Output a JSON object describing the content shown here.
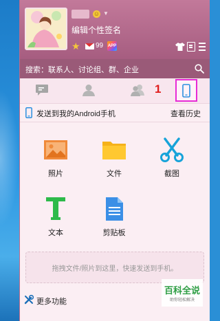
{
  "profile": {
    "signature": "编辑个性签名",
    "mail_count": "99",
    "app_badge": "APP",
    "level_icon": "gold-vip-badge"
  },
  "search": {
    "placeholder": "搜索：联系人、讨论组、群、企业"
  },
  "tabs": {
    "annotation_number": "1",
    "items": [
      {
        "icon": "message-icon"
      },
      {
        "icon": "contact-icon"
      },
      {
        "icon": "group-icon"
      },
      {
        "icon": "phone-icon"
      }
    ],
    "active_index": 3
  },
  "send_panel": {
    "title": "发送到我的Android手机",
    "history": "查看历史"
  },
  "actions": [
    {
      "label": "照片",
      "icon": "photo-icon"
    },
    {
      "label": "文件",
      "icon": "folder-icon"
    },
    {
      "label": "截图",
      "icon": "scissors-icon"
    },
    {
      "label": "文本",
      "icon": "text-icon"
    },
    {
      "label": "剪贴板",
      "icon": "clipboard-icon"
    }
  ],
  "dropzone": {
    "text": "拖拽文件/照片到这里，快速发送到手机。"
  },
  "more": {
    "label": "更多功能"
  },
  "watermark": {
    "title": "百科全说",
    "subtitle": "助你轻松解决"
  },
  "colors": {
    "header": "#b26a8c",
    "search_bar": "#9a5a78",
    "panel_bg": "#fbeef3",
    "highlight": "#e72bd6",
    "annotation": "#e01c1c"
  }
}
